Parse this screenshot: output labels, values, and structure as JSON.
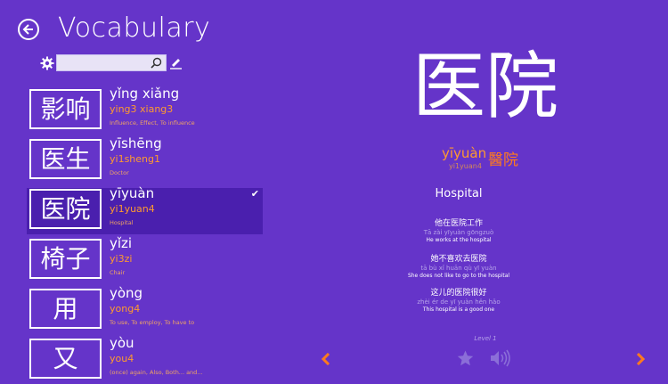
{
  "header": {
    "title": "Vocabulary"
  },
  "search": {
    "value": ""
  },
  "words": [
    {
      "hanzi": "影响",
      "pinyin": "yǐng xiǎng",
      "numbered": "ying3 xiang3",
      "definition": "Influence, Effect, To influence"
    },
    {
      "hanzi": "医生",
      "pinyin": "yīshēng",
      "numbered": "yi1sheng1",
      "definition": "Doctor"
    },
    {
      "hanzi": "医院",
      "pinyin": "yīyuàn",
      "numbered": "yi1yuan4",
      "definition": "Hospital"
    },
    {
      "hanzi": "椅子",
      "pinyin": "yǐzi",
      "numbered": "yi3zi",
      "definition": "Chair"
    },
    {
      "hanzi": "用",
      "pinyin": "yòng",
      "numbered": "yong4",
      "definition": "To use, To employ, To have to"
    },
    {
      "hanzi": "又",
      "pinyin": "yòu",
      "numbered": "you4",
      "definition": "(once) again, Also, Both... and..."
    }
  ],
  "selected_index": 2,
  "detail": {
    "hanzi": "医院",
    "pinyin": "yīyuàn",
    "traditional": "醫院",
    "numbered": "yi1yuan4",
    "meaning": "Hospital",
    "examples": [
      {
        "zh": "他在医院工作",
        "pinyin": "Tā zài yīyuàn gōngzuò",
        "en": "He works at the hospital"
      },
      {
        "zh": "她不喜欢去医院",
        "pinyin": "tā bù xǐ huān qù yī yuàn",
        "en": "She does not like to go to the hospital"
      },
      {
        "zh": "这儿的医院很好",
        "pinyin": "zhèi ér de yī yuàn hěn hǎo",
        "en": "This hospital is a good one"
      }
    ],
    "level": "Level 1"
  },
  "colors": {
    "background": "#6534c9",
    "selected_row": "#4a1fae",
    "accent_orange": "#ff9a2e"
  },
  "icons": [
    "back-arrow-icon",
    "gear-icon",
    "search-icon",
    "edit-icon",
    "check-icon",
    "star-icon",
    "speaker-icon",
    "prev-arrow-icon",
    "next-arrow-icon"
  ]
}
